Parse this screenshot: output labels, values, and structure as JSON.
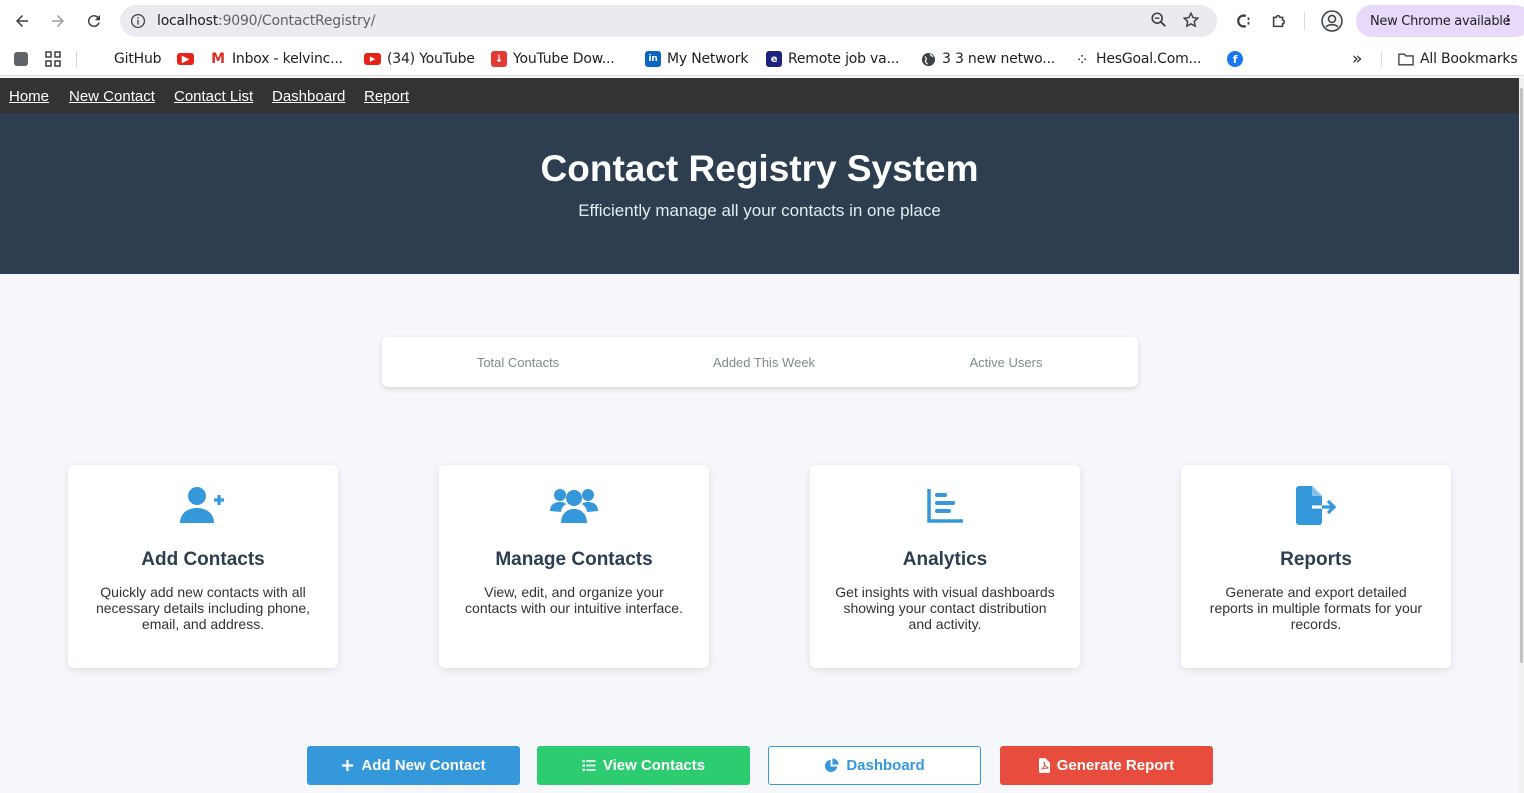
{
  "browser": {
    "url_host": "localhost",
    "url_path": ":9090/ContactRegistry/",
    "update_label": "New Chrome available",
    "bookmarks": [
      {
        "label": "GitHub",
        "icon": "github-icon"
      },
      {
        "label": "Inbox - kelvinc...",
        "icon": "gmail-icon"
      },
      {
        "label": "(34) YouTube",
        "icon": "youtube-icon"
      },
      {
        "label": "YouTube Dow...",
        "icon": "download-icon"
      },
      {
        "label": "My Network",
        "icon": "linkedin-icon"
      },
      {
        "label": "Remote job va...",
        "icon": "remote-job-icon"
      },
      {
        "label": "3 3 new netwo...",
        "icon": "globe-icon"
      },
      {
        "label": "HesGoal.Com...",
        "icon": "hesgoal-icon"
      }
    ],
    "more_label": "»",
    "all_bookmarks_label": "All Bookmarks"
  },
  "nav": {
    "home": "Home",
    "new_contact": "New Contact",
    "contact_list": "Contact List",
    "dashboard": "Dashboard",
    "report": "Report"
  },
  "hero": {
    "title": "Contact Registry System",
    "subtitle": "Efficiently manage all your contacts in one place"
  },
  "stats": {
    "total": "Total Contacts",
    "week": "Added This Week",
    "active": "Active Users"
  },
  "features": [
    {
      "title": "Add Contacts",
      "description": "Quickly add new contacts with all necessary details including phone, email, and address.",
      "icon": "user-plus-icon"
    },
    {
      "title": "Manage Contacts",
      "description": "View, edit, and organize your contacts with our intuitive interface.",
      "icon": "users-icon"
    },
    {
      "title": "Analytics",
      "description": "Get insights with visual dashboards showing your contact distribution and activity.",
      "icon": "chart-bar-icon"
    },
    {
      "title": "Reports",
      "description": "Generate and export detailed reports in multiple formats for your records.",
      "icon": "file-export-icon"
    }
  ],
  "actions": {
    "add": "Add New Contact",
    "view": "View Contacts",
    "dashboard": "Dashboard",
    "report": "Generate Report"
  },
  "colors": {
    "accent": "#3498db",
    "hero_bg": "#2c3e50",
    "success": "#2ecc71",
    "danger": "#e74c3c"
  }
}
